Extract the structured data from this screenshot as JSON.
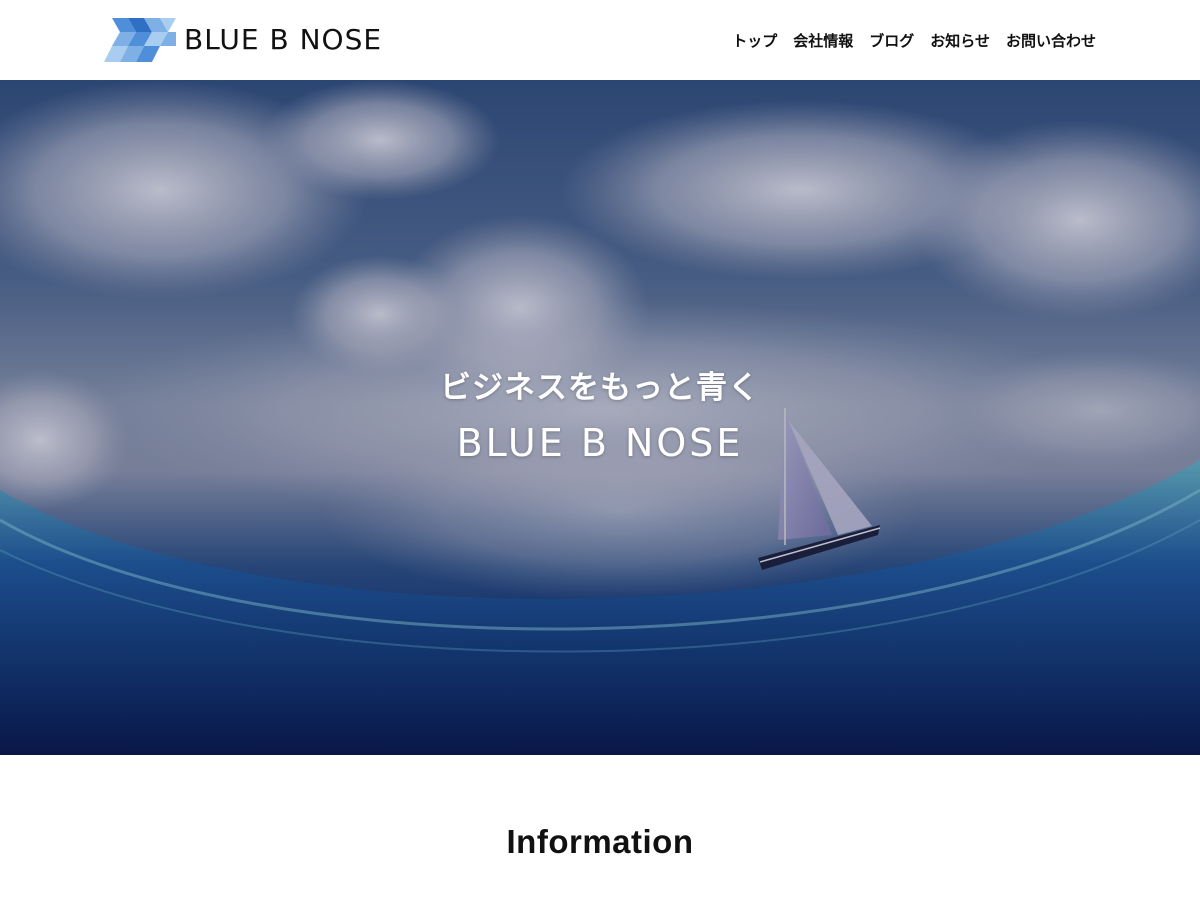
{
  "header": {
    "logo_text": "BLUE B NOSE",
    "logo_colors": [
      "#4f8fd9",
      "#7eb0e6",
      "#a9cdf0",
      "#2f6fc4"
    ],
    "nav": [
      {
        "label": "トップ"
      },
      {
        "label": "会社情報"
      },
      {
        "label": "ブログ"
      },
      {
        "label": "お知らせ"
      },
      {
        "label": "お問い合わせ"
      }
    ]
  },
  "hero": {
    "tagline": "ビジネスをもっと青く",
    "brand": "BLUE B NOSE"
  },
  "information": {
    "title": "Information",
    "items": [
      {
        "date": "",
        "headline": ""
      }
    ]
  },
  "colors": {
    "text": "#111111",
    "hero_sky": "#33507f",
    "hero_sea": "#0a1d55",
    "hero_sea_highlight": "#5fb7c9"
  }
}
